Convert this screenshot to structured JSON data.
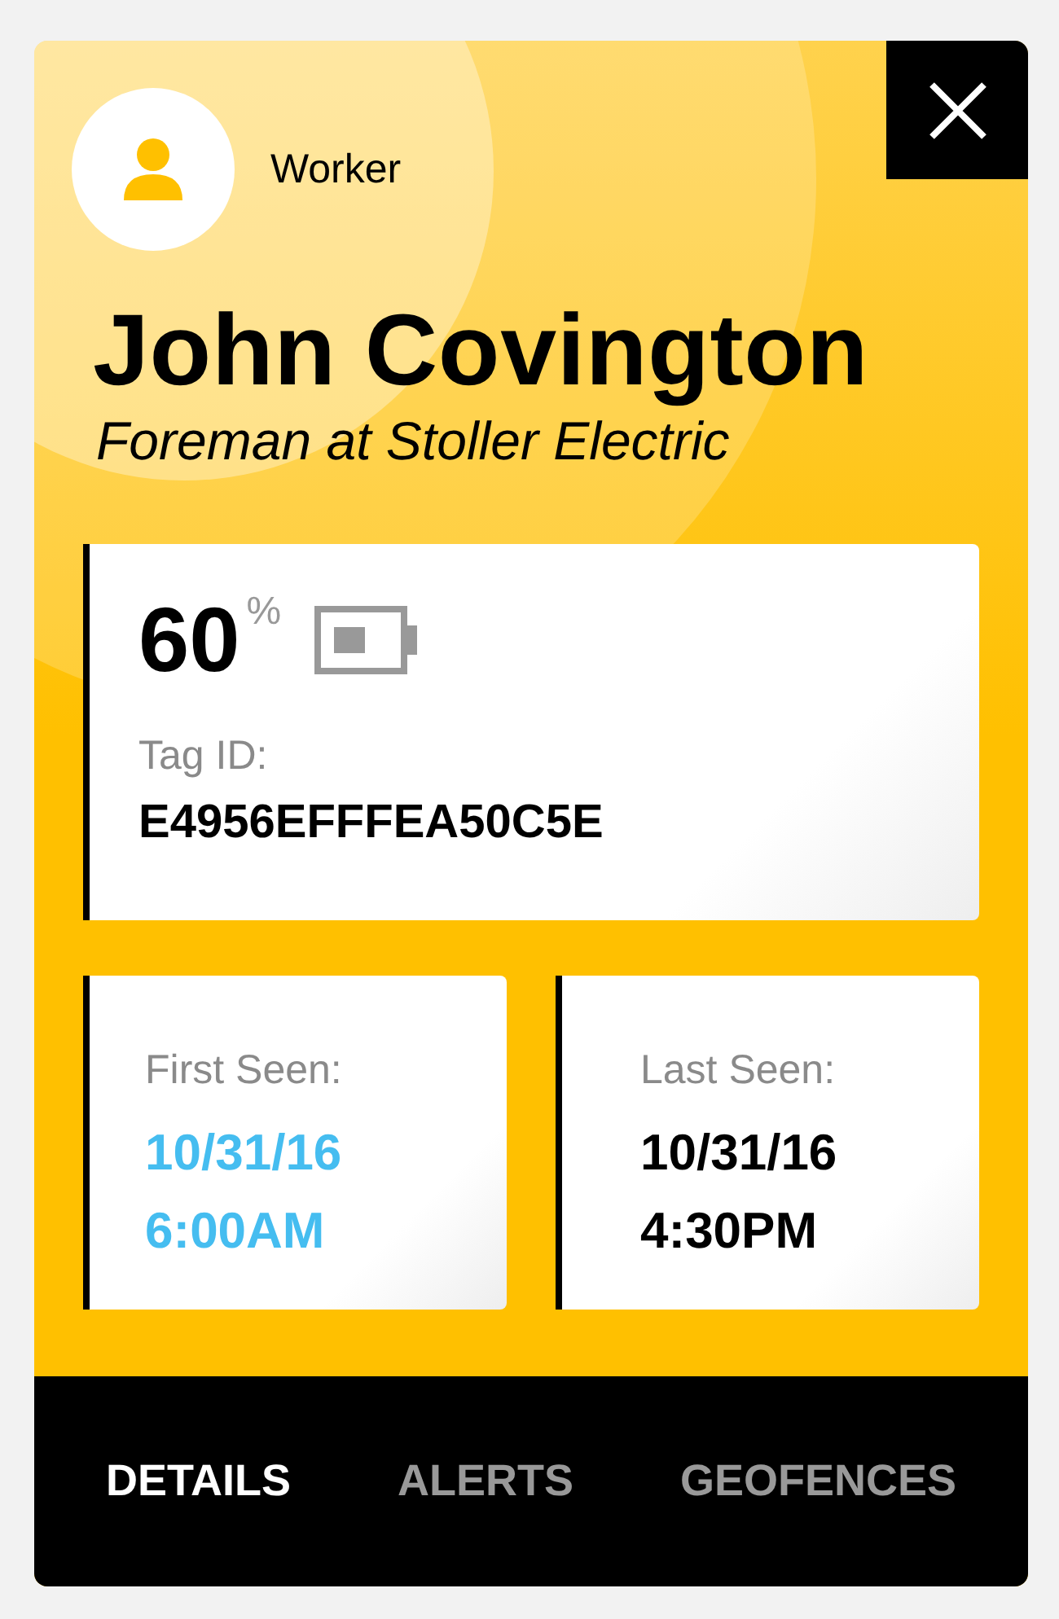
{
  "header": {
    "role": "Worker",
    "name": "John Covington",
    "title": "Foreman at Stoller Electric"
  },
  "battery": {
    "percent": "60",
    "unit": "%"
  },
  "tag": {
    "label": "Tag ID:",
    "value": "E4956EFFFEA50C5E"
  },
  "seen": [
    {
      "label": "First Seen:",
      "date": "10/31/16",
      "time": "6:00AM",
      "color": "#45bdf0"
    },
    {
      "label": "Last Seen:",
      "date": "10/31/16",
      "time": "4:30PM",
      "color": "#000000"
    }
  ],
  "tabs": [
    {
      "label": "DETAILS",
      "selected": true
    },
    {
      "label": "ALERTS",
      "selected": false
    },
    {
      "label": "GEOFENCES",
      "selected": false
    }
  ]
}
